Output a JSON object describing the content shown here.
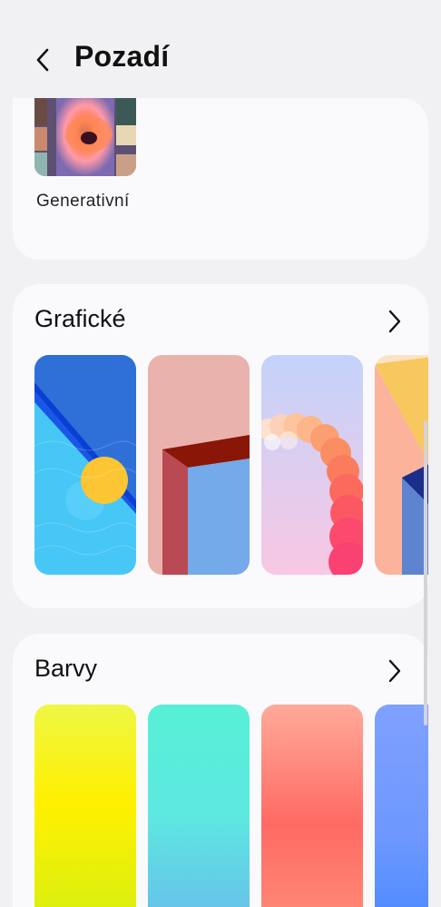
{
  "header": {
    "title": "Pozadí",
    "back_icon": "back-arrow-icon"
  },
  "sections": {
    "generative": {
      "label": "Generativní"
    },
    "graphic": {
      "title": "Grafické",
      "more_icon": "chevron-right-icon"
    },
    "colors": {
      "title": "Barvy",
      "more_icon": "chevron-right-icon"
    }
  },
  "colors_palette": {
    "background": "#f1f1f4",
    "card": "#fafafd"
  }
}
